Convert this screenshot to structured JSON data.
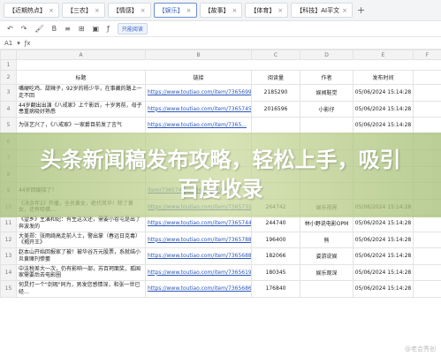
{
  "tabs": [
    {
      "label": "【近期热点】",
      "active": false
    },
    {
      "label": "【三农】",
      "active": false
    },
    {
      "label": "【情感】",
      "active": false
    },
    {
      "label": "【娱乐】",
      "active": true
    },
    {
      "label": "【故事】",
      "active": false
    },
    {
      "label": "【体育】",
      "active": false
    },
    {
      "label": "【科技】AI平文",
      "active": false
    }
  ],
  "toolbar": {
    "filter_label": "只能阅读"
  },
  "formula": {
    "cell": "A1"
  },
  "columns": [
    "A",
    "B",
    "C",
    "D",
    "E",
    "F",
    "G"
  ],
  "header_row": {
    "title": "标题",
    "link": "链接",
    "reads": "阅读量",
    "author": "作者",
    "date": "发布时间"
  },
  "rows": [
    {
      "num": "3",
      "title": "嘴硬吃鸡、甜辣子，92岁的杨少华，在事藏的路上一走不回",
      "link": "https://www.toutiao.com/item/7365699673312543267/",
      "reads": "2185290",
      "author": "娱闻鞋觉",
      "date": "05/06/2024 15:14:28"
    },
    {
      "num": "4",
      "title": "44岁翻出出演《八戒家》上个影后，十岁男前，母子患重病吸好熟悉",
      "link": "https://www.toutiao.com/item/7365745229962642698/",
      "reads": "2016596",
      "author": "小影仔",
      "date": "05/06/2024 15:14:28"
    },
    {
      "num": "5",
      "title": "为张艺兴了，《八戒家》一家爵目前发了言气",
      "link": "https://www.toutiao.com/item/7365...",
      "reads": "",
      "author": "",
      "date": "05/06/2024 15:14:28"
    },
    {
      "num": "6",
      "title": "",
      "link": "",
      "reads": "",
      "author": "",
      "date": ""
    },
    {
      "num": "7",
      "title": "",
      "link": "",
      "reads": "",
      "author": "",
      "date": ""
    },
    {
      "num": "8",
      "title": "",
      "link": "",
      "reads": "",
      "author": "",
      "date": ""
    },
    {
      "num": "9",
      "title": "44岁回缓接了！",
      "link": "item/7365749684366916992/",
      "reads": "",
      "author": "",
      "date": ""
    },
    {
      "num": "10",
      "title": "《决余年2》开播，全员黄女，绝代风华！除了黄女，还有哈佛...",
      "link": "https://www.toutiao.com/item/7365731179545723443/",
      "reads": "264742",
      "author": "娱乐视界",
      "date": "05/06/2024 15:14:28"
    },
    {
      "num": "11",
      "title": "《望乡》主演和妃：有生这次还，需要小卷屯是出了奔波发的",
      "link": "https://www.toutiao.com/item/7365744819107727679/",
      "reads": "244740",
      "author": "林小野说电影OPM",
      "date": "05/06/2024 15:14:28"
    },
    {
      "num": "12",
      "title": "大美郑：张雨绮高走前人士，警出掌（春远日克毒）《揭开王》",
      "link": "https://www.toutiao.com/item/7365788082340280362/",
      "reads": "196400",
      "author": "熊",
      "date": "05/06/2024 15:14:28"
    },
    {
      "num": "13",
      "title": "赵本山开始回报家了被！被华谷万元股票，系就结小炎黄赌刊惨萎",
      "link": "https://www.toutiao.com/item/7365688515869938129/",
      "reads": "182066",
      "author": "姿游说娱",
      "date": "05/06/2024 15:14:28"
    },
    {
      "num": "14",
      "title": "中法税差大一次，仍有影响一部，苏百珂面奖，孤国家需要后去电影圈",
      "link": "https://www.toutiao.com/item/7365619502491254311/",
      "reads": "180345",
      "author": "娱乐观深",
      "date": "05/06/2024 15:14:28"
    },
    {
      "num": "15",
      "title": "何炅打一个\"剑瑕\"同为，男发您感情深，和张一世已经...",
      "link": "https://www.toutiao.com/item/7365686050151141156/",
      "reads": "176840",
      "author": "",
      "date": "05/06/2024 15:14:28"
    }
  ],
  "banner": {
    "text": "头条新闻稿发布攻略，轻松上手，吸引百度收录"
  },
  "watermark": {
    "text": "@老会秀创"
  }
}
